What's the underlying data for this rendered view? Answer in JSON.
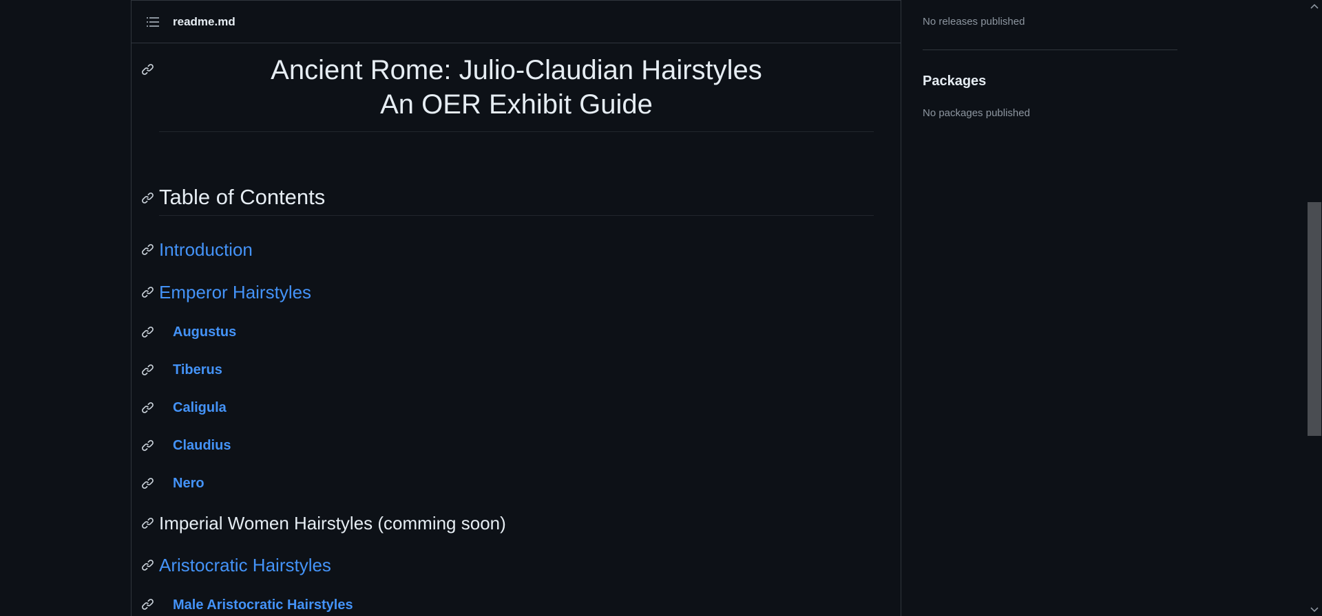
{
  "readme": {
    "filename": "readme.md",
    "title_line1": "Ancient Rome: Julio-Claudian Hairstyles",
    "title_line2": "An OER Exhibit Guide",
    "toc_heading": "Table of Contents",
    "toc": [
      {
        "label": "Introduction",
        "level": 3,
        "link": true
      },
      {
        "label": "Emperor Hairstyles",
        "level": 3,
        "link": true
      },
      {
        "label": "Augustus",
        "level": 4,
        "link": true
      },
      {
        "label": "Tiberus",
        "level": 4,
        "link": true
      },
      {
        "label": "Caligula",
        "level": 4,
        "link": true
      },
      {
        "label": "Claudius",
        "level": 4,
        "link": true
      },
      {
        "label": "Nero",
        "level": 4,
        "link": true
      },
      {
        "label": "Imperial Women Hairstyles (comming soon)",
        "level": 3,
        "link": false
      },
      {
        "label": "Aristocratic Hairstyles",
        "level": 3,
        "link": true
      },
      {
        "label": "Male Aristocratic Hairstyles",
        "level": 4,
        "link": true
      }
    ]
  },
  "sidebar": {
    "releases_text": "No releases published",
    "packages_heading": "Packages",
    "packages_text": "No packages published"
  },
  "icons": {
    "toc": "list-unordered-icon",
    "anchor": "link-icon",
    "scroll_up": "chevron-up-icon",
    "scroll_down": "chevron-down-icon"
  },
  "colors": {
    "background": "#0d1117",
    "text": "#e6edf3",
    "link": "#4493f8",
    "muted": "#8d96a0",
    "border": "#30363d"
  }
}
